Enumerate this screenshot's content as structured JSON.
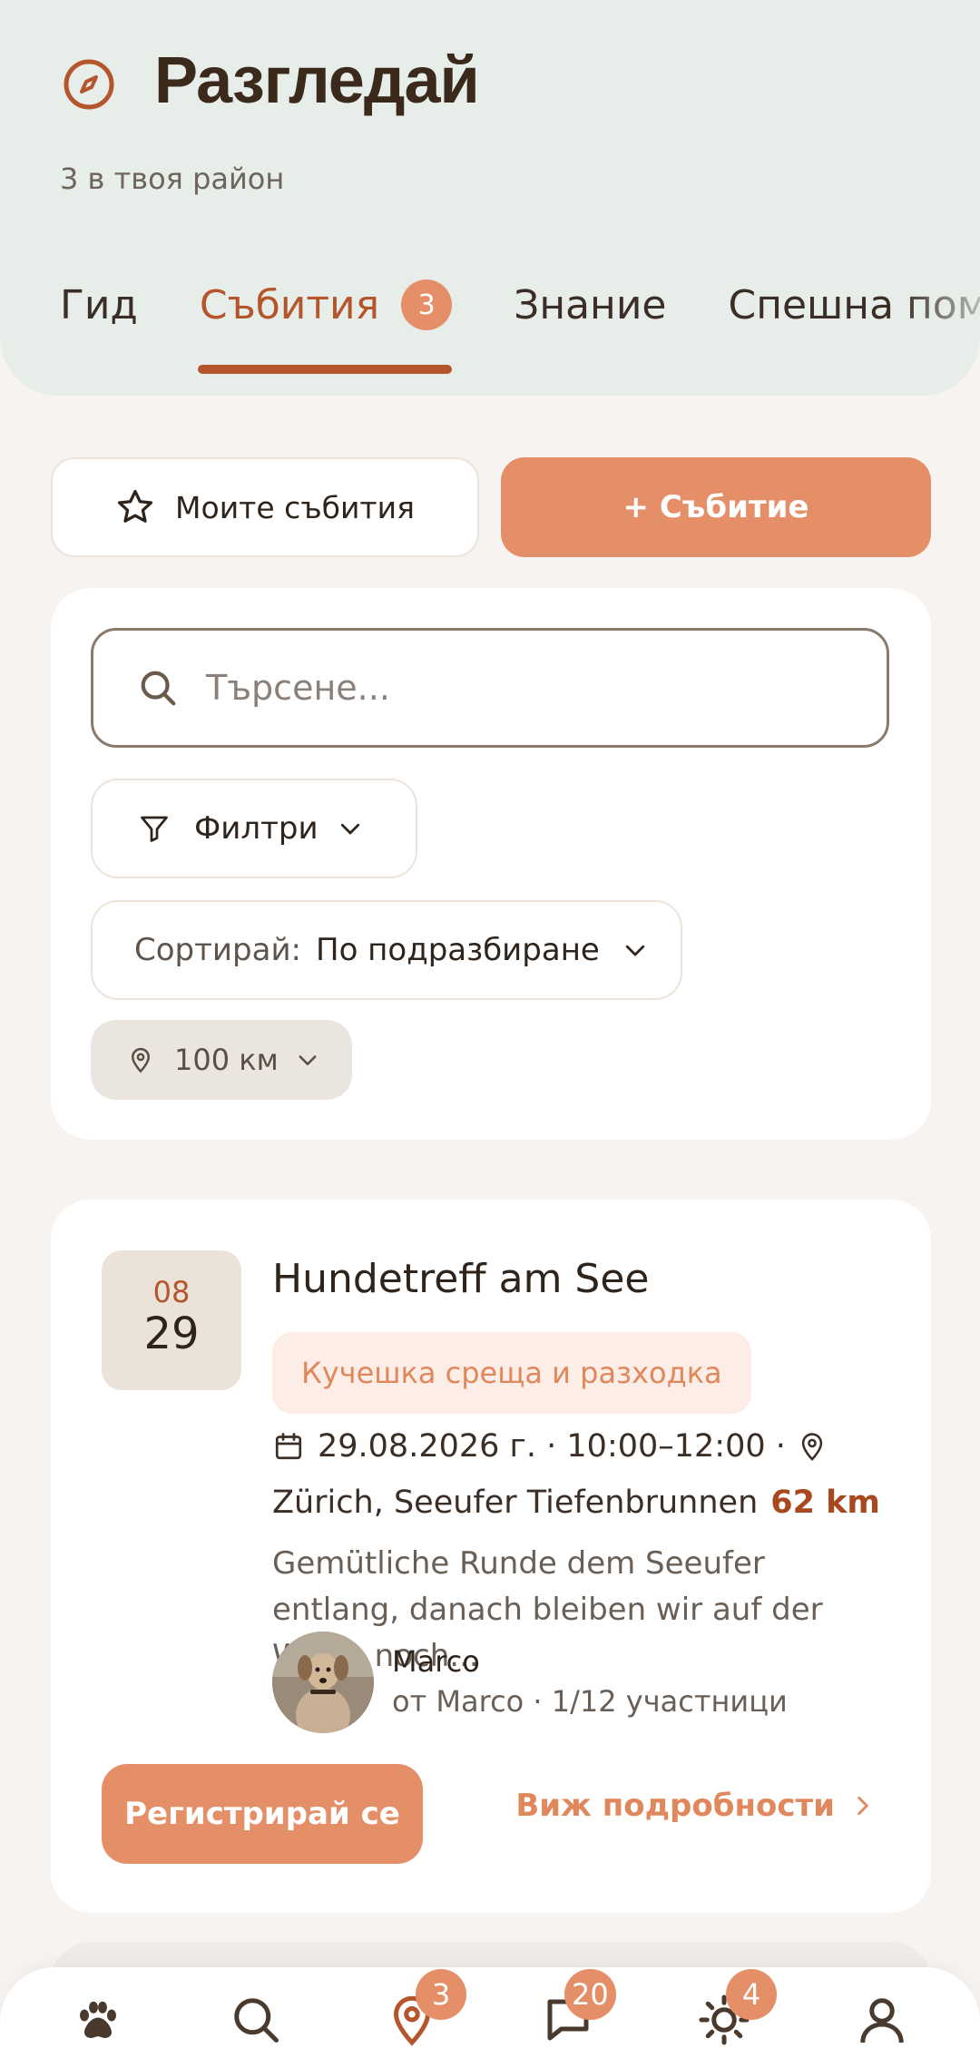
{
  "header": {
    "title": "Разгледай",
    "subtitle": "3 в твоя район",
    "tabs": [
      {
        "label": "Гид",
        "active": false
      },
      {
        "label": "Събития",
        "active": true,
        "badge": "3"
      },
      {
        "label": "Знание",
        "active": false
      },
      {
        "label": "Спешна помо",
        "active": false
      }
    ]
  },
  "actions": {
    "my_events_label": "Моите събития",
    "add_event_label": "+ Събитие"
  },
  "filters": {
    "search_placeholder": "Търсене...",
    "filters_label": "Филтри",
    "sort_label": "Сортирай:",
    "sort_value": "По подразбиране",
    "distance_value": "100 км"
  },
  "event": {
    "month": "08",
    "day": "29",
    "title": "Hundetreff am See",
    "tag": "Кучешка среща и разходка",
    "datetime": "29.08.2026 г. · 10:00–12:00 ·",
    "location": "Zürich, Seeufer Tiefenbrunnen",
    "distance": "62 km",
    "description": "Gemütliche Runde dem Seeufer entlang, danach bleiben wir auf der Wiese noch...",
    "organizer_name": "Marco",
    "organizer_meta": "от Marco · 1/12 участници",
    "register_label": "Регистрирай се",
    "details_label": "Виж подробности"
  },
  "bottom_nav": {
    "items": [
      {
        "icon": "paw-icon"
      },
      {
        "icon": "search-icon"
      },
      {
        "icon": "map-pin-icon",
        "badge": "3"
      },
      {
        "icon": "chat-icon",
        "badge": "20"
      },
      {
        "icon": "sun-icon",
        "badge": "4"
      },
      {
        "icon": "user-icon"
      }
    ]
  },
  "colors": {
    "accent": "#e48f68",
    "accent_dark": "#b5552c",
    "header_bg": "#e7eee9",
    "page_bg": "#f7f3f0"
  }
}
